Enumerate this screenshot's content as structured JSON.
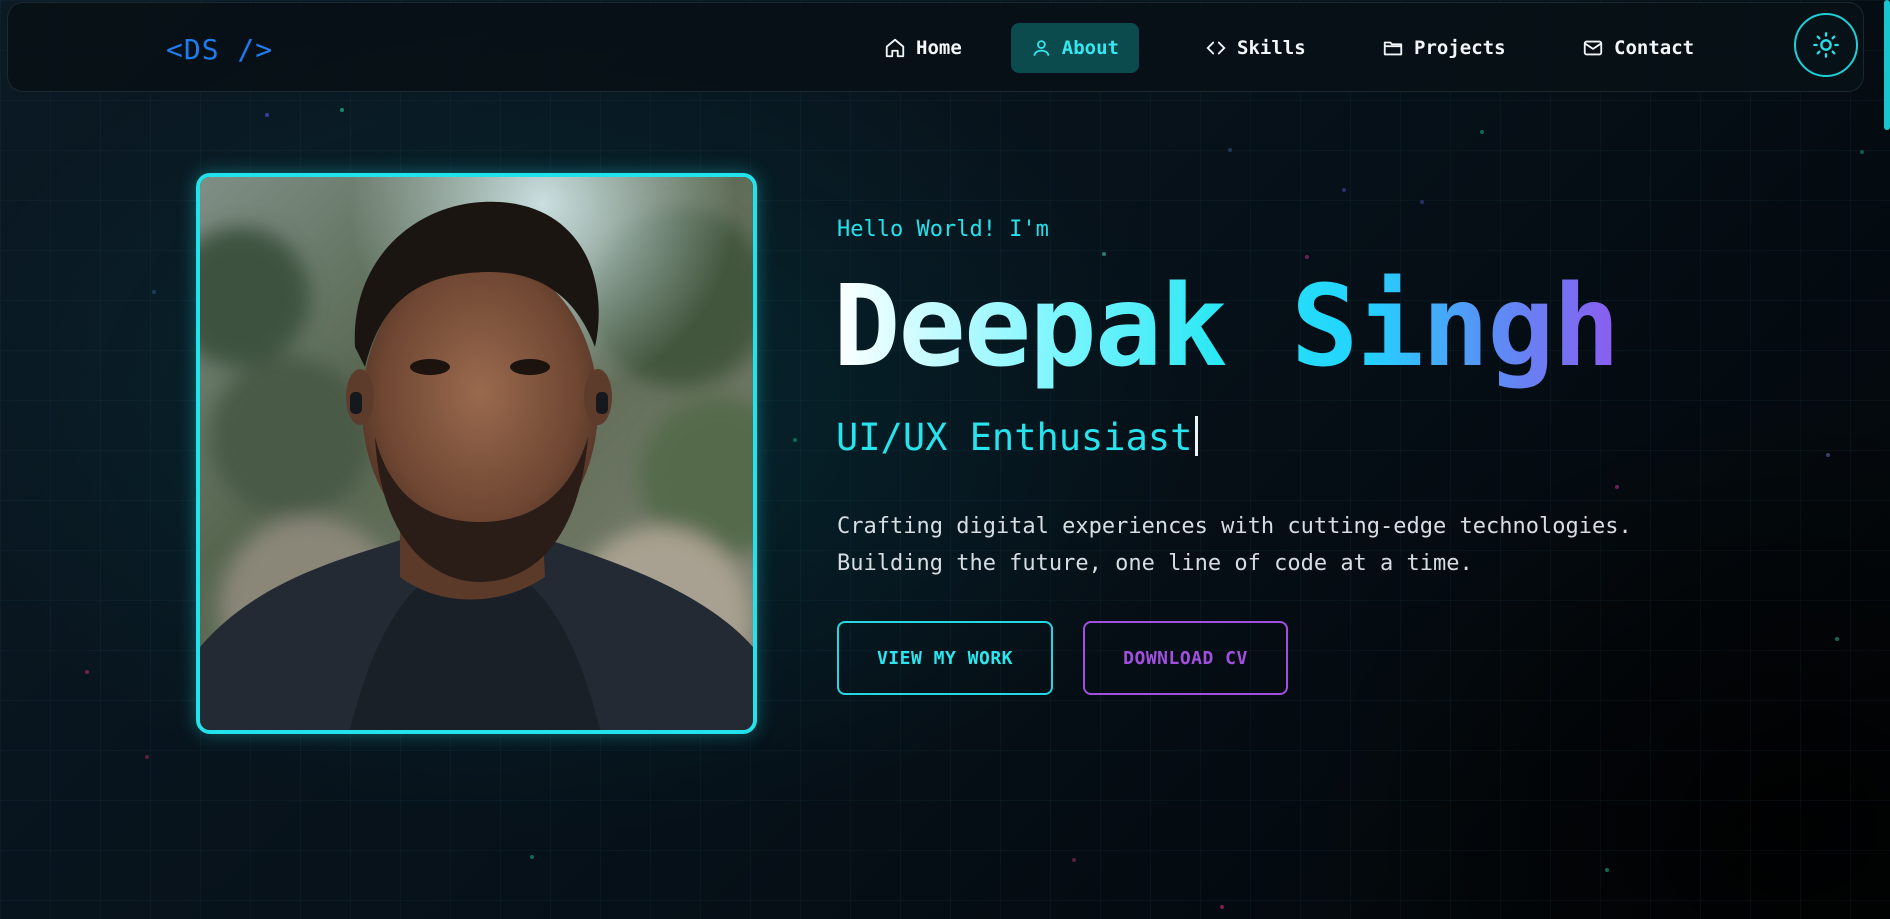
{
  "brand": {
    "logo": "<DS />"
  },
  "nav": {
    "items": [
      {
        "label": "Home",
        "icon": "home-icon"
      },
      {
        "label": "About",
        "icon": "user-icon",
        "active": true
      },
      {
        "label": "Skills",
        "icon": "code-icon"
      },
      {
        "label": "Projects",
        "icon": "folder-icon"
      },
      {
        "label": "Contact",
        "icon": "mail-icon"
      }
    ],
    "theme_toggle_icon": "sun-icon"
  },
  "hero": {
    "greeting": "Hello World! I'm",
    "name": "Deepak Singh",
    "role": "UI/UX Enthusiast",
    "description_line1": "Crafting digital experiences with cutting-edge technologies.",
    "description_line2": "Building the future, one line of code at a time.",
    "primary_button": "VIEW MY WORK",
    "secondary_button": "DOWNLOAD CV"
  },
  "colors": {
    "accent_cyan": "#22e3ec",
    "accent_purple": "#a24fe0",
    "logo_blue": "#1f7cf0",
    "background": "#07111a"
  }
}
